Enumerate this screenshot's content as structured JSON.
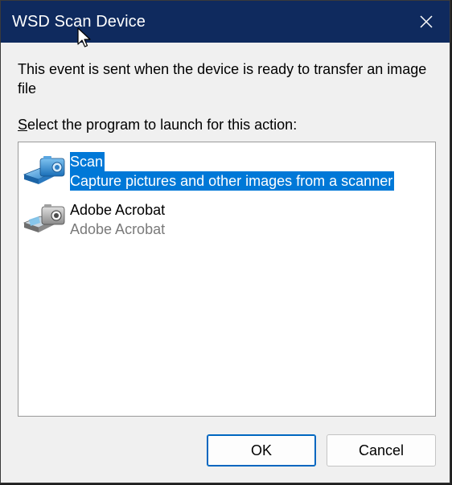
{
  "window": {
    "title": "WSD Scan Device"
  },
  "dialog": {
    "description": "This event is sent when the device is ready to transfer an image file",
    "select_label_accel": "S",
    "select_label_rest": "elect the program to launch for this action:"
  },
  "programs": [
    {
      "title": "Scan",
      "subtitle": "Capture pictures and other images from a scanner",
      "icon": "scanner-icon",
      "selected": true
    },
    {
      "title": "Adobe Acrobat",
      "subtitle": "Adobe Acrobat",
      "icon": "camera-scanner-icon",
      "selected": false
    }
  ],
  "buttons": {
    "ok_label": "OK",
    "cancel_label": "Cancel"
  },
  "colors": {
    "titlebar": "#0f2a5e",
    "selection": "#0078d7",
    "background": "#f0f0f0"
  }
}
